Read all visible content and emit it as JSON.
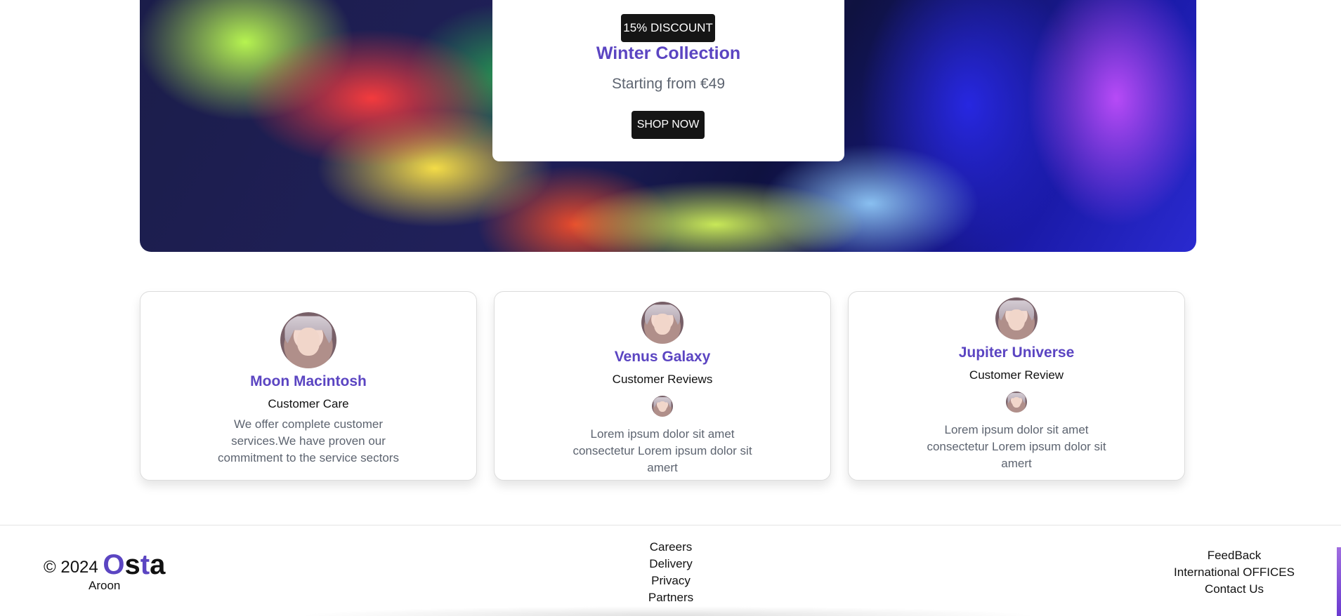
{
  "hero": {
    "badge": "15% DISCOUNT",
    "title": "Winter Collection",
    "subtitle": "Starting from €49",
    "button": "SHOP NOW"
  },
  "cards": [
    {
      "name": "Moon Macintosh",
      "role": "Customer Care",
      "text": "We offer complete customer services.We have proven our commitment to the service sectors"
    },
    {
      "name": "Venus Galaxy",
      "role": "Customer Reviews",
      "text": "Lorem ipsum dolor sit amet consectetur Lorem ipsum dolor sit amert"
    },
    {
      "name": "Jupiter Universe",
      "role": "Customer Review",
      "text": "Lorem ipsum dolor sit amet consectetur Lorem ipsum dolor sit amert"
    }
  ],
  "footer": {
    "copyright": "© 2024",
    "brand": {
      "o": "O",
      "s": "s",
      "t": "t",
      "a": "a"
    },
    "owner": "Aroon",
    "links_mid": [
      "Careers",
      "Delivery",
      "Privacy",
      "Partners"
    ],
    "links_right": [
      "FeedBack",
      "International OFFICES",
      "Contact Us"
    ]
  },
  "colors": {
    "accent": "#5b45c2",
    "dark": "#151515",
    "muted": "#5d6470"
  },
  "icons": [
    "avatar-icon"
  ]
}
